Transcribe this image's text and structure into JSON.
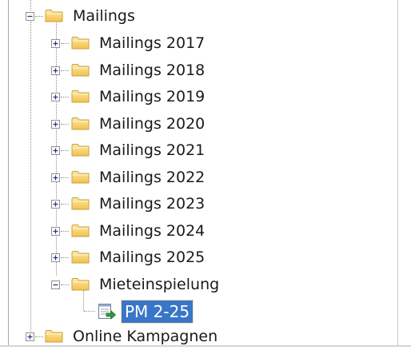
{
  "tree": {
    "root": {
      "label": "Mailings",
      "expanded": true,
      "icon": "folder-icon"
    },
    "children": [
      {
        "label": "Mailings 2017",
        "expanded": false,
        "icon": "folder-icon"
      },
      {
        "label": "Mailings 2018",
        "expanded": false,
        "icon": "folder-icon"
      },
      {
        "label": "Mailings 2019",
        "expanded": false,
        "icon": "folder-icon"
      },
      {
        "label": "Mailings 2020",
        "expanded": false,
        "icon": "folder-icon"
      },
      {
        "label": "Mailings 2021",
        "expanded": false,
        "icon": "folder-icon"
      },
      {
        "label": "Mailings 2022",
        "expanded": false,
        "icon": "folder-icon"
      },
      {
        "label": "Mailings 2023",
        "expanded": false,
        "icon": "folder-icon"
      },
      {
        "label": "Mailings 2024",
        "expanded": false,
        "icon": "folder-icon"
      },
      {
        "label": "Mailings 2025",
        "expanded": false,
        "icon": "folder-icon"
      },
      {
        "label": "Mieteinspielung",
        "expanded": true,
        "icon": "folder-icon"
      }
    ],
    "leaf": {
      "label": "PM 2-25",
      "selected": true,
      "icon": "document-arrow-icon"
    },
    "sibling": {
      "label": "Online Kampagnen",
      "expanded": false,
      "icon": "folder-icon"
    },
    "colors": {
      "selection": "#3a76c8",
      "folder": "#f4c95d",
      "tree_lines": "#8e8e8e"
    }
  }
}
